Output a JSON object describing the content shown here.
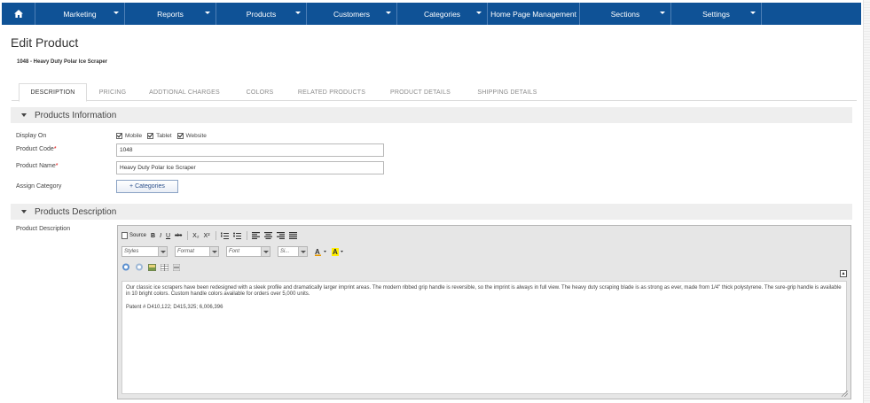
{
  "nav": {
    "home_icon": "home-icon",
    "items": [
      {
        "label": "Marketing"
      },
      {
        "label": "Reports"
      },
      {
        "label": "Products"
      },
      {
        "label": "Customers"
      },
      {
        "label": "Categories"
      },
      {
        "label": "Home Page Management"
      },
      {
        "label": "Sections"
      },
      {
        "label": "Settings"
      }
    ]
  },
  "page": {
    "title": "Edit Product",
    "subtitle": "1048 - Heavy Duty Polar Ice Scraper"
  },
  "tabs": [
    {
      "label": "DESCRIPTION",
      "active": true
    },
    {
      "label": "PRICING"
    },
    {
      "label": "ADDTIONAL CHARGES"
    },
    {
      "label": "COLORS"
    },
    {
      "label": "RELATED PRODUCTS"
    },
    {
      "label": "PRODUCT DETAILS"
    },
    {
      "label": "SHIPPING DETAILS"
    }
  ],
  "info_section": {
    "title": "Products Information",
    "display_on_label": "Display On",
    "display_options": [
      {
        "label": "Mobile",
        "checked": true
      },
      {
        "label": "Tablet",
        "checked": true
      },
      {
        "label": "Website",
        "checked": true
      }
    ],
    "product_code_label": "Product Code",
    "product_code_value": "1048",
    "product_name_label": "Product Name",
    "product_name_value": "Heavy Duty Polar Ice Scraper",
    "required_mark": "*",
    "assign_category_label": "Assign Category",
    "categories_button": "+ Categories"
  },
  "desc_section": {
    "title": "Products Description",
    "field_label": "Product Description",
    "toolbar": {
      "source": "Source",
      "bold": "B",
      "italic": "I",
      "underline": "U",
      "strike": "abc",
      "subscript": "X₂",
      "superscript": "X²",
      "styles": "Styles",
      "format": "Format",
      "font": "Font",
      "size": "Si..."
    },
    "paragraphs": [
      "Our classic ice scrapers have been redesigned with a sleek profile and dramatically larger imprint areas. The modern ribbed grip handle is reversible, so the imprint is always in full view. The heavy duty scraping blade is as strong as ever, made from 1/4\" thick polystyrene. The sure-grip handle is available in 10 bright colors. Custom handle colors available for orders over 5,000 units.",
      "Patent # D410,122; D415,325; 6,006,396"
    ]
  },
  "colors": {
    "nav_bg": "#0f5296",
    "section_bg": "#eeeeee",
    "required": "#dd0000"
  }
}
